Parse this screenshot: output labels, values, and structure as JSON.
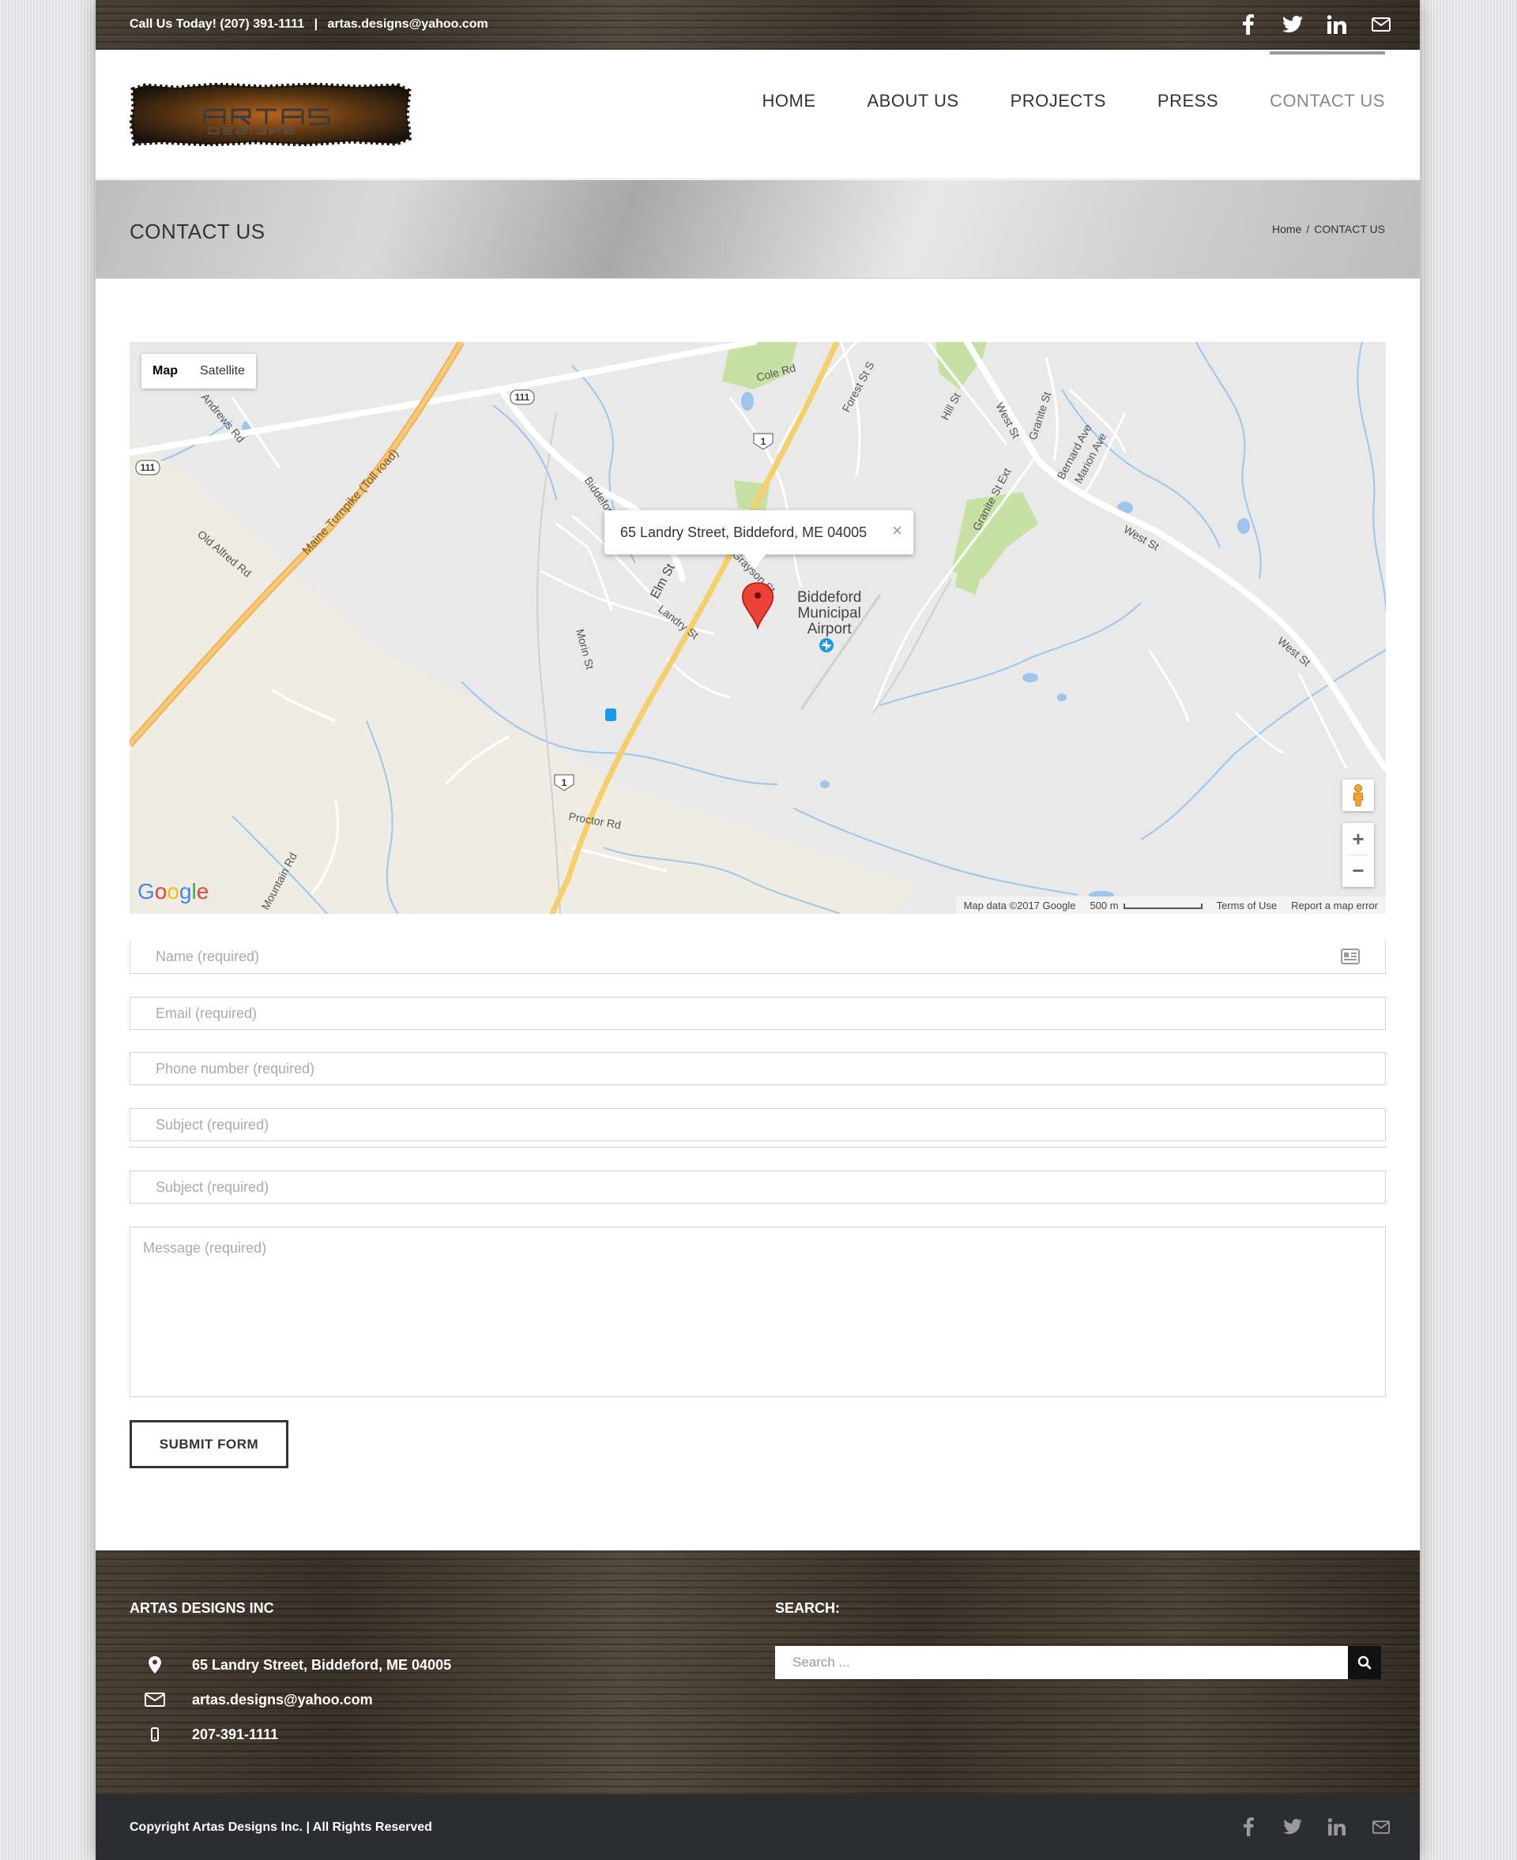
{
  "topbar": {
    "phone_text": "Call Us Today! (207) 391-1111",
    "separator": "|",
    "email": "artas.designs@yahoo.com"
  },
  "social_icons": [
    "facebook-icon",
    "twitter-icon",
    "linkedin-icon",
    "mail-icon"
  ],
  "nav": {
    "items": [
      {
        "label": "HOME"
      },
      {
        "label": "ABOUT US"
      },
      {
        "label": "PROJECTS"
      },
      {
        "label": "PRESS"
      },
      {
        "label": "CONTACT US",
        "active": true
      }
    ]
  },
  "page_title": "CONTACT US",
  "breadcrumb": {
    "home": "Home",
    "separator": "/",
    "current": "CONTACT US"
  },
  "map": {
    "type_map": "Map",
    "type_satellite": "Satellite",
    "info_address": "65 Landry Street, Biddeford, ME 04005",
    "close_glyph": "×",
    "airport_line1": "Biddeford",
    "airport_line2": "Municipal",
    "airport_line3": "Airport",
    "zoom_in": "+",
    "zoom_out": "−",
    "data_credit": "Map data ©2017 Google",
    "scale": "500 m",
    "terms": "Terms of Use",
    "report": "Report a map error",
    "labels": {
      "cole_rd": "Cole Rd",
      "forest_st": "Forest St S",
      "hill_st": "Hill St",
      "west_st": "West St",
      "granite_st": "Granite St",
      "bernard_ave": "Bernard Ave",
      "marion_ave": "Marion Ave",
      "granite_st_ext": "Granite St Ext",
      "andrews_rd": "Andrews Rd",
      "maine_turnpike": "Maine Turnpike (Toll road)",
      "old_alfred_rd": "Old Alfred Rd",
      "biddeford": "Biddeford",
      "elm_st": "Elm St",
      "landry_st": "Landry St",
      "morin_st": "Morin St",
      "grayson_st": "Grayson St",
      "proctor_rd": "Proctor Rd",
      "mountain_rd": "Mountain Rd",
      "route_111": "111",
      "route_1": "1"
    },
    "colors": {
      "land": "#e9e9e9",
      "highway": "#f6bf69",
      "road": "#ffffff",
      "water": "#9ec5ec",
      "park": "#c6e1a3",
      "pin": "#ea4335"
    }
  },
  "form": {
    "name_placeholder": "Name (required)",
    "email_placeholder": "Email (required)",
    "phone_placeholder": "Phone number (required)",
    "subject1_placeholder": "Subject (required)",
    "subject2_placeholder": "Subject (required)",
    "message_placeholder": "Message (required)",
    "submit_label": "SUBMIT FORM"
  },
  "footer": {
    "company_heading": "ARTAS DESIGNS INC",
    "address": "65 Landry Street, Biddeford, ME 04005",
    "email": "artas.designs@yahoo.com",
    "phone": "207-391-1111",
    "search_heading": "SEARCH:",
    "search_placeholder": "Search ..."
  },
  "copyright": "Copyright Artas Designs Inc. | All Rights Reserved"
}
